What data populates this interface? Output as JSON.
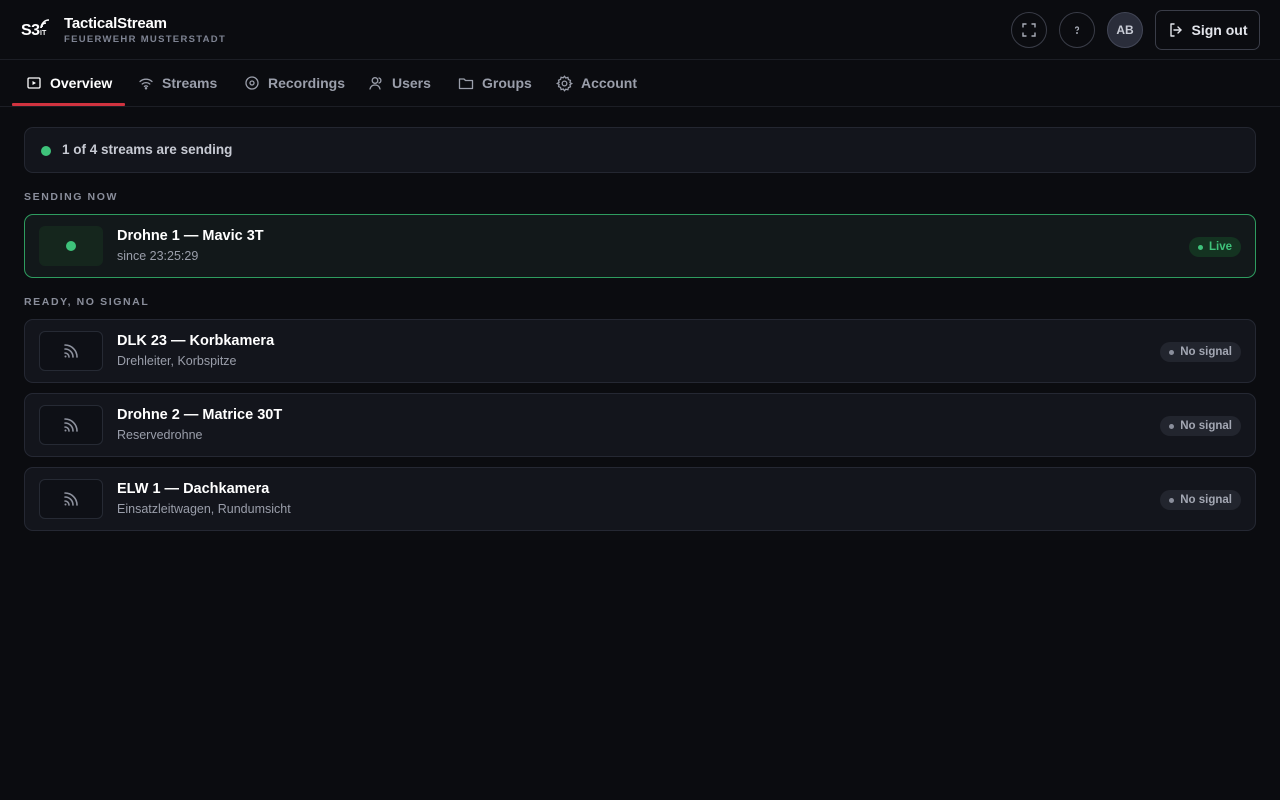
{
  "header": {
    "logo_text": "S3",
    "logo_sub": "IT",
    "title": "TacticalStream",
    "subtitle": "FEUERWEHR MUSTERSTADT",
    "fullscreen_icon": "fullscreen-icon",
    "help_icon": "help-icon",
    "avatar_initials": "AB",
    "signout_label": "Sign out",
    "signout_icon": "sign-out-icon"
  },
  "tabs": [
    {
      "label": "Overview",
      "icon": "play-square-icon",
      "active": true
    },
    {
      "label": "Streams",
      "icon": "wifi-icon",
      "active": false
    },
    {
      "label": "Recordings",
      "icon": "record-icon",
      "active": false
    },
    {
      "label": "Users",
      "icon": "user-icon",
      "active": false
    },
    {
      "label": "Groups",
      "icon": "folder-icon",
      "active": false
    },
    {
      "label": "Account",
      "icon": "gear-icon",
      "active": false
    }
  ],
  "summary": {
    "text": "1 of 4 streams are sending",
    "status_color": "#3ec27a"
  },
  "sections": {
    "sending_label": "SENDING NOW",
    "ready_label": "READY, NO SIGNAL"
  },
  "sending": [
    {
      "name": "Drohne 1 — Mavic 3T",
      "desc": "since 23:25:29",
      "badge": "Live"
    }
  ],
  "ready": [
    {
      "name": "DLK 23 — Korbkamera",
      "desc": "Drehleiter, Korbspitze",
      "badge": "No signal"
    },
    {
      "name": "Drohne 2 — Matrice 30T",
      "desc": "Reservedrohne",
      "badge": "No signal"
    },
    {
      "name": "ELW 1 — Dachkamera",
      "desc": "Einsatzleitwagen, Rundumsicht",
      "badge": "No signal"
    }
  ],
  "colors": {
    "accent": "#d0333f",
    "live": "#3ec27a",
    "background": "#0b0c10"
  }
}
